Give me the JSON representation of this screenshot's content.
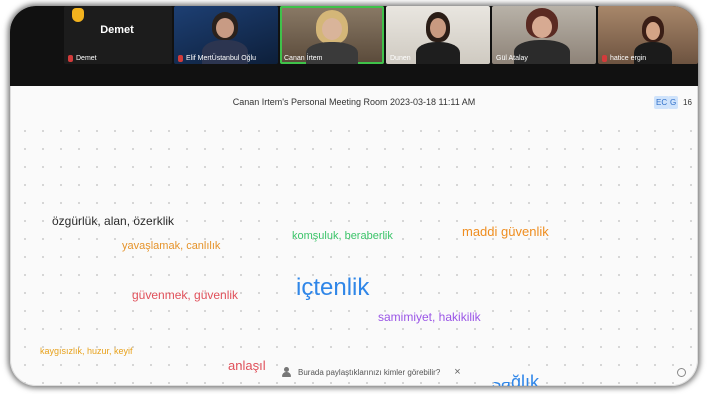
{
  "participants": [
    {
      "name": "Demet",
      "display_big": "Demet",
      "muted": true,
      "hand_raised": true,
      "video": false
    },
    {
      "name": "Elif MertÜstanbul Oğlu",
      "muted": true,
      "video": true
    },
    {
      "name": "Canan İrtem",
      "muted": false,
      "video": true
    },
    {
      "name": "Dunen",
      "muted": false,
      "video": true
    },
    {
      "name": "Gül Atalay",
      "muted": false,
      "video": true
    },
    {
      "name": "hatice ergin",
      "muted": true,
      "video": true
    }
  ],
  "meeting": {
    "title": "Canan Irtem's Personal Meeting Room 2023-03-18 11:11 AM",
    "badges": [
      "EC",
      "G",
      "16"
    ]
  },
  "words": [
    {
      "text": "özgürlük, alan, özerklik",
      "color": "#2b2b2b"
    },
    {
      "text": "yavaşlamak, canlılık",
      "color": "#e5932a"
    },
    {
      "text": "komşuluk, beraberlik",
      "color": "#3cc46a"
    },
    {
      "text": "maddi güvenlik",
      "color": "#ef8d1f"
    },
    {
      "text": "güvenmek, güvenlik",
      "color": "#e0505a"
    },
    {
      "text": "içtenlik",
      "color": "#2f86e8"
    },
    {
      "text": "samimiyet, hakikilik",
      "color": "#9a55e6"
    },
    {
      "text": "kaygısızlık, huzur, keyif",
      "color": "#e8a21c"
    },
    {
      "text": "anlaşıl",
      "color": "#e0505a"
    },
    {
      "text": "sağlık",
      "color": "#2f86e8"
    }
  ],
  "banner": {
    "text": "Burada paylaştıklarınızı kimler görebilir?",
    "close": "×"
  },
  "colors": {
    "topbar": "#111111",
    "board": "#fafafa"
  }
}
